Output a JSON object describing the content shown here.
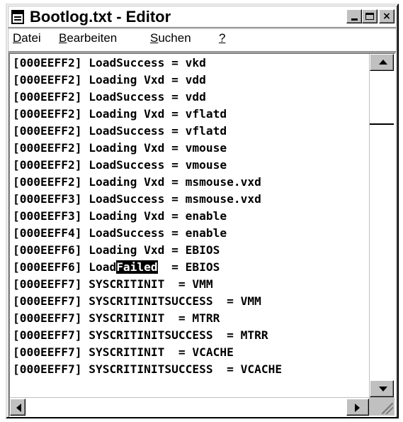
{
  "window": {
    "title": "Bootlog.txt - Editor",
    "controls": {
      "minimize": "_",
      "maximize": "□",
      "close": "×"
    }
  },
  "menu": {
    "items": [
      {
        "mnemonic": "D",
        "rest": "atei"
      },
      {
        "mnemonic": "B",
        "rest": "earbeiten"
      },
      {
        "mnemonic": "S",
        "rest": "uchen"
      },
      {
        "mnemonic": "?",
        "rest": ""
      }
    ]
  },
  "editor": {
    "lines": [
      {
        "pre": "[000EEFF2] LoadSuccess = vkd",
        "sel": "",
        "post": ""
      },
      {
        "pre": "[000EEFF2] Loading Vxd = vdd",
        "sel": "",
        "post": ""
      },
      {
        "pre": "[000EEFF2] LoadSuccess = vdd",
        "sel": "",
        "post": ""
      },
      {
        "pre": "[000EEFF2] Loading Vxd = vflatd",
        "sel": "",
        "post": ""
      },
      {
        "pre": "[000EEFF2] LoadSuccess = vflatd",
        "sel": "",
        "post": ""
      },
      {
        "pre": "[000EEFF2] Loading Vxd = vmouse",
        "sel": "",
        "post": ""
      },
      {
        "pre": "[000EEFF2] LoadSuccess = vmouse",
        "sel": "",
        "post": ""
      },
      {
        "pre": "[000EEFF2] Loading Vxd = msmouse.vxd",
        "sel": "",
        "post": ""
      },
      {
        "pre": "[000EEFF3] LoadSuccess = msmouse.vxd",
        "sel": "",
        "post": ""
      },
      {
        "pre": "[000EEFF3] Loading Vxd = enable",
        "sel": "",
        "post": ""
      },
      {
        "pre": "[000EEFF4] LoadSuccess = enable",
        "sel": "",
        "post": ""
      },
      {
        "pre": "[000EEFF6] Loading Vxd = EBIOS",
        "sel": "",
        "post": ""
      },
      {
        "pre": "[000EEFF6] Load",
        "sel": "Failed",
        "post": "  = EBIOS"
      },
      {
        "pre": "[000EEFF7] SYSCRITINIT  = VMM",
        "sel": "",
        "post": ""
      },
      {
        "pre": "[000EEFF7] SYSCRITINITSUCCESS  = VMM",
        "sel": "",
        "post": ""
      },
      {
        "pre": "[000EEFF7] SYSCRITINIT  = MTRR",
        "sel": "",
        "post": ""
      },
      {
        "pre": "[000EEFF7] SYSCRITINITSUCCESS  = MTRR",
        "sel": "",
        "post": ""
      },
      {
        "pre": "[000EEFF7] SYSCRITINIT  = VCACHE",
        "sel": "",
        "post": ""
      },
      {
        "pre": "[000EEFF7] SYSCRITINITSUCCESS  = VCACHE",
        "sel": "",
        "post": ""
      }
    ],
    "vertical_scroll_position": 0.18,
    "horizontal_scroll_position": 0.0
  },
  "icons": {
    "app": "notepad-icon",
    "cursor": "text-cursor-icon"
  }
}
